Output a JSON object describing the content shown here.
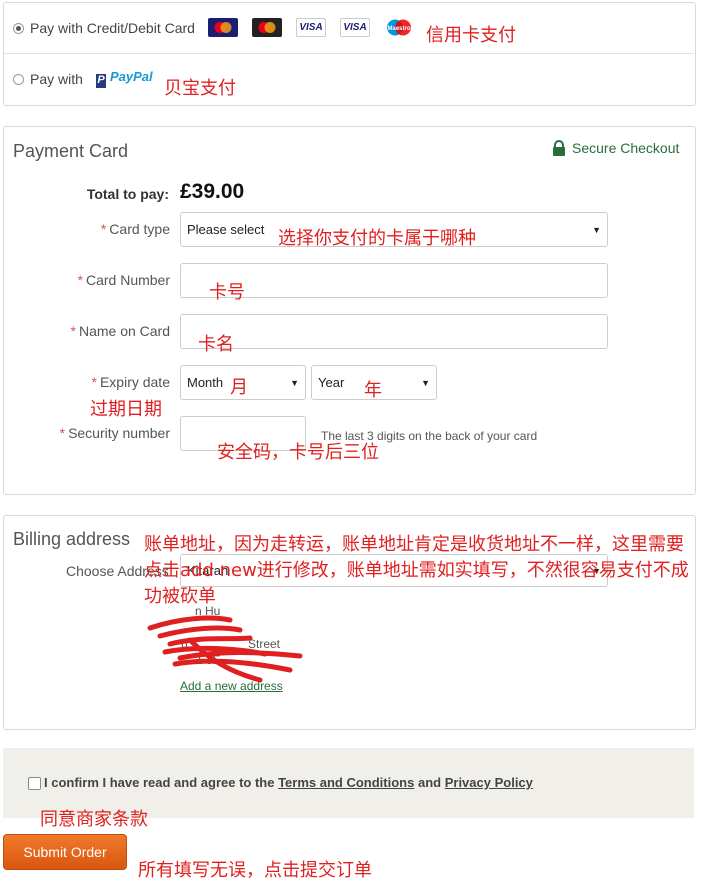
{
  "payment_options": {
    "card_label": "Pay with Credit/Debit Card",
    "card_logos": [
      {
        "name": "mastercard",
        "text": "MasterCard"
      },
      {
        "name": "mastercard-2",
        "text": "MasterCard"
      },
      {
        "name": "visa",
        "text": "VISA"
      },
      {
        "name": "visa-electron",
        "text": "VISA"
      },
      {
        "name": "maestro",
        "text": "Maestro"
      }
    ],
    "paypal_label": "Pay with",
    "paypal_brand": "PayPal",
    "note_card": "信用卡支付",
    "note_paypal": "贝宝支付"
  },
  "payment_card": {
    "title": "Payment Card",
    "secure": "Secure Checkout",
    "total_label": "Total to pay:",
    "total_value": "£39.00",
    "card_type_label": "Card type",
    "card_type_value": "Please select",
    "card_number_label": "Card Number",
    "name_label": "Name on Card",
    "expiry_label": "Expiry date",
    "month_value": "Month",
    "year_value": "Year",
    "security_label": "Security number",
    "security_hint": "The last 3 digits on the back of your card",
    "notes": {
      "card_type": "选择你支付的卡属于哪种",
      "card_number": "卡号",
      "name": "卡名",
      "month": "月",
      "year": "年",
      "expiry": "过期日期",
      "security": "安全码，卡号后三位"
    }
  },
  "billing": {
    "title": "Billing address",
    "choose_label": "Choose Address",
    "address_lines": [
      "Kitarah",
      "n Hu",
      "6",
      "Street",
      "1 3E"
    ],
    "add_link": "Add a new address",
    "note": "账单地址，因为走转运，账单地址肯定是收货地址不一样，这里需要点击add new进行修改，账单地址需如实填写，不然很容易支付不成功被砍单"
  },
  "terms": {
    "prefix": "I confirm I have read and agree to the",
    "terms_link": "Terms and Conditions",
    "and": "and",
    "privacy_link": "Privacy Policy",
    "note": "同意商家条款"
  },
  "submit": {
    "label": "Submit Order",
    "note": "所有填写无误，点击提交订单"
  },
  "colors": {
    "accent_orange": "#e8621a",
    "annotation_red": "#e02020",
    "secure_green": "#2a6c3e"
  }
}
